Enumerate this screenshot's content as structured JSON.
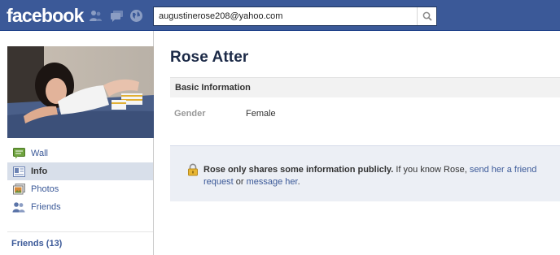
{
  "topbar": {
    "logo_text": "facebook",
    "icons": [
      "friend-requests-icon",
      "messages-icon",
      "notifications-globe-icon"
    ],
    "search": {
      "value": "augustinerose208@yahoo.com",
      "placeholder": ""
    }
  },
  "sidebar": {
    "items": [
      {
        "label": "Wall",
        "icon": "wall-icon",
        "active": false
      },
      {
        "label": "Info",
        "icon": "info-icon",
        "active": true
      },
      {
        "label": "Photos",
        "icon": "photos-icon",
        "active": false
      },
      {
        "label": "Friends",
        "icon": "friends-icon",
        "active": false
      }
    ],
    "friends_link": "Friends (13)"
  },
  "profile": {
    "name": "Rose Atter",
    "section_title": "Basic Information",
    "fields": [
      {
        "label": "Gender",
        "value": "Female"
      }
    ]
  },
  "notice": {
    "bold_text": "Rose only shares some information publicly.",
    "text1": " If you know Rose, ",
    "link1": "send her a friend request",
    "text2": " or ",
    "link2": "message her",
    "text3": "."
  },
  "colors": {
    "brand_blue": "#3b5998",
    "active_nav_bg": "#d8dfea",
    "notice_bg": "#eceff5"
  }
}
